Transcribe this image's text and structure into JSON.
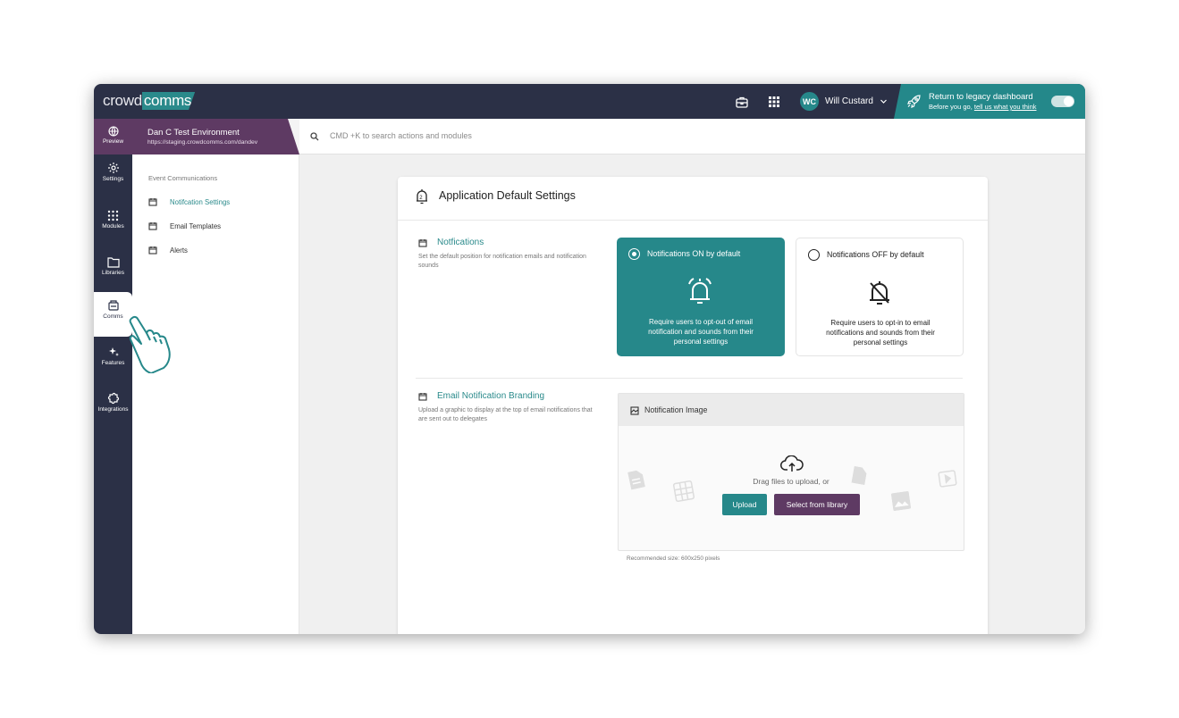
{
  "app": {
    "logo_left": "crowd",
    "logo_right": "comms",
    "user_initials": "WC",
    "user_name": "Will Custard",
    "legacy_title": "Return to legacy dashboard",
    "legacy_sub_prefix": "Before you go,",
    "legacy_sub_link": "tell us what you think"
  },
  "env": {
    "preview_label": "Preview",
    "title": "Dan C Test Environment",
    "url": "https://staging.crowdcomms.com/dandev"
  },
  "search": {
    "placeholder": "CMD +K to search actions and modules"
  },
  "sidenav": {
    "items": [
      {
        "label": "Settings"
      },
      {
        "label": "Modules"
      },
      {
        "label": "Libraries"
      },
      {
        "label": "Comms"
      },
      {
        "label": "Features"
      },
      {
        "label": "Integrations"
      }
    ]
  },
  "subnav": {
    "section": "Event Communications",
    "items": [
      {
        "label": "Notifcation Settings"
      },
      {
        "label": "Email Templates"
      },
      {
        "label": "Alerts"
      }
    ]
  },
  "card": {
    "title": "Application Default Settings",
    "notifications": {
      "title": "Notfications",
      "desc": "Set the default position for notification emails and notification sounds",
      "on_label": "Notifications ON by default",
      "on_desc": "Require users to opt-out of email notification and sounds from their personal settings",
      "off_label": "Notifications OFF by default",
      "off_desc": "Require users to opt-in to email notifications and sounds from their personal settings"
    },
    "branding": {
      "title": "Email Notification Branding",
      "desc": "Upload a graphic to display at the top of email notifications that are sent out to delegates",
      "image_header": "Notification Image",
      "drag_text": "Drag files to upload, or",
      "upload_button": "Upload",
      "library_button": "Select from library",
      "recommended": "Recommended size: 600x250 pixels"
    }
  },
  "colors": {
    "navy": "#2b3046",
    "teal": "#26888a",
    "purple": "#5e3a63"
  }
}
